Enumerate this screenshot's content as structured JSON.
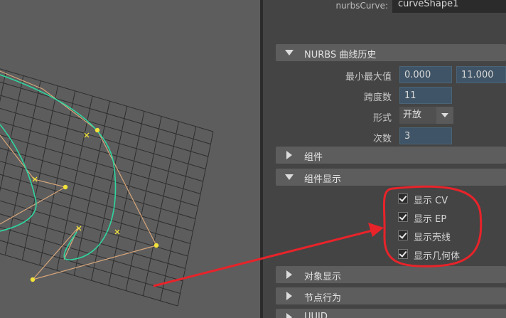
{
  "node": {
    "label": "nurbsCurve:",
    "value": "curveShape1"
  },
  "sections": {
    "history": {
      "title": "NURBS 曲线历史",
      "expanded": true
    },
    "components": {
      "title": "组件",
      "expanded": false
    },
    "component_display": {
      "title": "组件显示",
      "expanded": true
    },
    "object_display": {
      "title": "对象显示",
      "expanded": false
    },
    "node_behavior": {
      "title": "节点行为",
      "expanded": false
    },
    "uuid": {
      "title": "UUID",
      "expanded": false
    }
  },
  "history": {
    "min_max_label": "最小最大值",
    "min_value": "0.000",
    "max_value": "11.000",
    "spans_label": "跨度数",
    "spans_value": "11",
    "form_label": "形式",
    "form_value": "开放",
    "degree_label": "次数",
    "degree_value": "3"
  },
  "component_display": {
    "checkboxes": [
      {
        "label": "显示 CV",
        "checked": true
      },
      {
        "label": "显示 EP",
        "checked": true
      },
      {
        "label": "显示壳线",
        "checked": true
      },
      {
        "label": "显示几何体",
        "checked": true
      }
    ]
  },
  "colors": {
    "viewport_bg": "#5d5d5d",
    "grid": "#2e2e2e",
    "curve": "#2fd6a0",
    "hull": "#d7a579",
    "cv_point": "#f2e23a",
    "annotation": "#e8232a"
  },
  "icons": {
    "expanded": "triangle-down-icon",
    "collapsed": "triangle-right-icon",
    "dropdown": "chevron-down-icon",
    "check": "checkmark-icon"
  }
}
